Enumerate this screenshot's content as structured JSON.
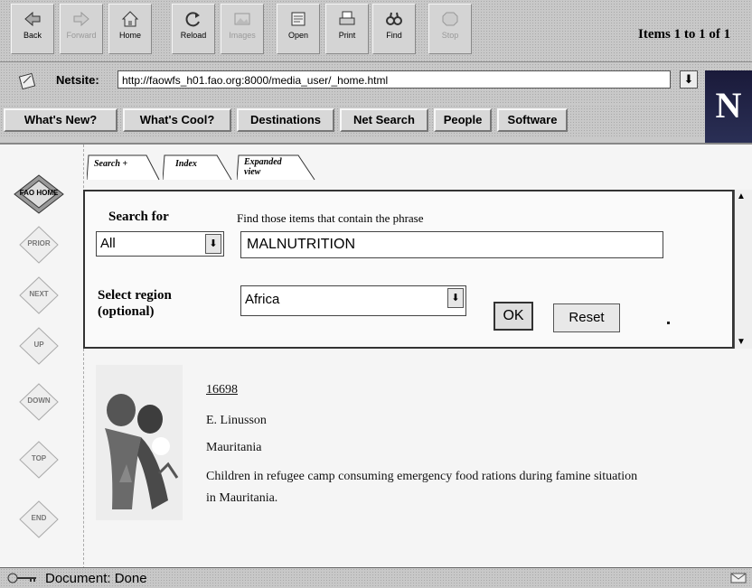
{
  "toolbar": {
    "buttons": [
      {
        "label": "Back",
        "icon": "back-icon",
        "enabled": true
      },
      {
        "label": "Forward",
        "icon": "forward-icon",
        "enabled": false
      },
      {
        "label": "Home",
        "icon": "home-icon",
        "enabled": true
      },
      {
        "label": "Reload",
        "icon": "reload-icon",
        "enabled": true
      },
      {
        "label": "Images",
        "icon": "images-icon",
        "enabled": false
      },
      {
        "label": "Open",
        "icon": "open-icon",
        "enabled": true
      },
      {
        "label": "Print",
        "icon": "print-icon",
        "enabled": true
      },
      {
        "label": "Find",
        "icon": "find-icon",
        "enabled": true
      },
      {
        "label": "Stop",
        "icon": "stop-icon",
        "enabled": false
      }
    ]
  },
  "location": {
    "label": "Netsite:",
    "url": "http://faowfs_h01.fao.org:8000/media_user/_home.html"
  },
  "logo": {
    "letter": "N"
  },
  "directory_buttons": [
    "What's New?",
    "What's Cool?",
    "Destinations",
    "Net Search",
    "People",
    "Software"
  ],
  "side_nav": [
    "FAO HOME",
    "PRIOR",
    "NEXT",
    "UP",
    "DOWN",
    "TOP",
    "END"
  ],
  "tabs": [
    "Search +",
    "Index",
    "Expanded view"
  ],
  "items_count": "Items 1 to 1 of 1",
  "search": {
    "search_for_label": "Search for",
    "phrase_label": "Find those items that  contain the phrase",
    "scope_value": "All",
    "phrase_value": "MALNUTRITION",
    "region_label_line1": "Select region",
    "region_label_line2": "(optional)",
    "region_value": "Africa",
    "ok_label": "OK",
    "reset_label": "Reset"
  },
  "result": {
    "id": "16698",
    "photographer": "E. Linusson",
    "country": "Mauritania",
    "caption_line1": "Children in refugee camp consuming emergency food rations during famine situation",
    "caption_line2": "in Mauritania."
  },
  "status": {
    "text": "Document: Done"
  }
}
